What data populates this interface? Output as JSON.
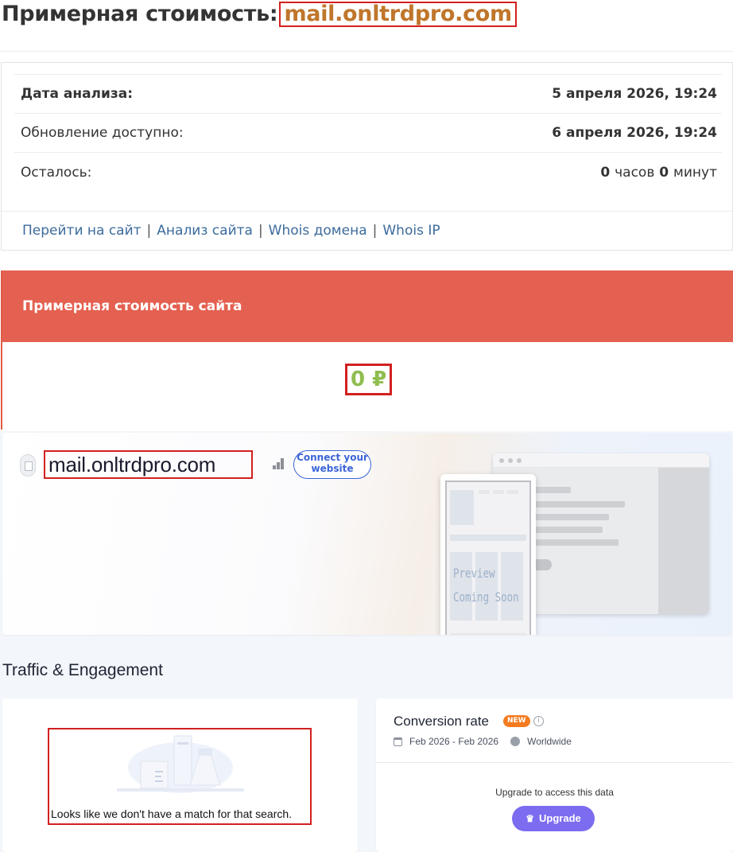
{
  "header": {
    "title_prefix": "Примерная стоимость:",
    "domain": "mail.onltrdpro.com"
  },
  "info": {
    "rows": [
      {
        "label": "Дата анализа:",
        "value": "5 апреля 2026, 19:24"
      },
      {
        "label": "Обновление доступно:",
        "value": "6 апреля 2026, 19:24"
      }
    ],
    "remaining": {
      "label": "Осталось:",
      "hours": "0",
      "hours_unit": "часов",
      "minutes": "0",
      "minutes_unit": "минут"
    },
    "links": [
      "Перейти на сайт",
      "Анализ сайта",
      "Whois домена",
      "Whois IP"
    ],
    "separator": "|"
  },
  "valuation": {
    "header": "Примерная стоимость сайта",
    "amount": "0 ₽",
    "amount_color": "#8fbd4f",
    "header_color": "#e46050"
  },
  "similarweb": {
    "domain": "mail.onltrdpro.com",
    "connect_button": "Connect your website",
    "preview_line1": "Preview",
    "preview_line2": "Coming Soon",
    "section_title": "Traffic & Engagement",
    "no_match_text": "Looks like we don't have a match for that search.",
    "conversion": {
      "title": "Conversion rate",
      "badge": "NEW",
      "date_range": "Feb 2026 - Feb 2026",
      "region": "Worldwide",
      "upgrade_text": "Upgrade to access this data",
      "upgrade_button": "Upgrade",
      "button_color": "#7c6cf0"
    }
  },
  "icons": [
    "favicon-icon",
    "signal-bars-icon",
    "info-icon",
    "calendar-icon",
    "globe-icon",
    "crown-icon"
  ]
}
